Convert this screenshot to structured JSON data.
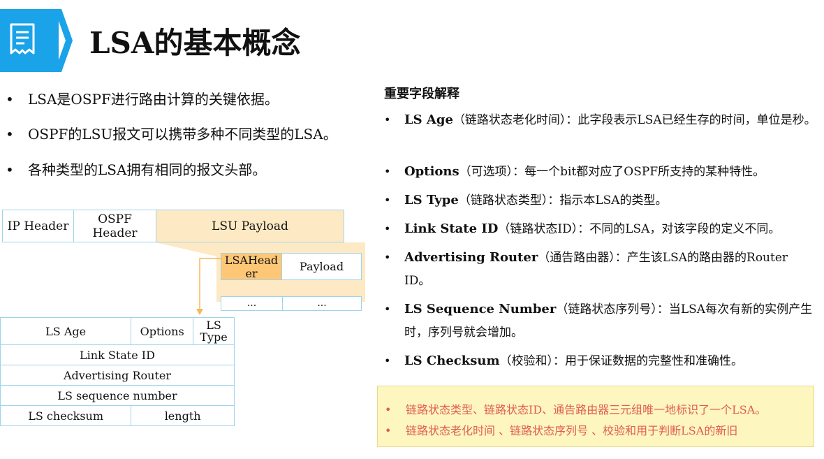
{
  "title": "LSA的基本概念",
  "left_bullets": [
    "LSA是OSPF进行路由计算的关键依据。",
    "OSPF的LSU报文可以携带多种不同类型的LSA。",
    "各种类型的LSA拥有相同的报文头部。"
  ],
  "packet": {
    "ip_header": "IP Header",
    "ospf_header": "OSPF Header",
    "lsu_payload": "LSU Payload",
    "lsa_header": "LSAHeader",
    "payload": "Payload",
    "ellipsis": "..."
  },
  "lsa_table": {
    "ls_age": "LS Age",
    "options": "Options",
    "ls_type": "LS Type",
    "link_state_id": "Link State ID",
    "advertising_router": "Advertising Router",
    "ls_sequence_number": "LS sequence number",
    "ls_checksum": "LS checksum",
    "length": "length"
  },
  "fields_heading": "重要字段解释",
  "fields": [
    {
      "name": "LS Age",
      "desc": "（链路状态老化时间）：此字段表示LSA已经生存的时间，单位是秒。"
    },
    {
      "name": "Options",
      "desc": "（可选项）：每一个bit都对应了OSPF所支持的某种特性。"
    },
    {
      "name": "LS Type",
      "desc": "（链路状态类型）：指示本LSA的类型。"
    },
    {
      "name": "Link State ID",
      "desc": "（链路状态ID）：不同的LSA，对该字段的定义不同。"
    },
    {
      "name": "Advertising Router",
      "desc": "（通告路由器）：产生该LSA的路由器的Router ID。"
    },
    {
      "name": "LS Sequence Number",
      "desc": "（链路状态序列号）：当LSA每次有新的实例产生时，序列号就会增加。"
    },
    {
      "name": "LS Checksum",
      "desc": "（校验和）：用于保证数据的完整性和准确性。"
    }
  ],
  "notes": [
    "链路状态类型、链路状态ID、通告路由器三元组唯一地标识了一个LSA。",
    "链路状态老化时间 、链路状态序列号 、校验和用于判断LSA的新旧"
  ],
  "colors": {
    "accent": "#1aa3e8",
    "highlight": "#fdc776",
    "payload_fill": "#fde9c4",
    "note_bg": "#fdf6bf",
    "note_text": "#e05d52"
  }
}
